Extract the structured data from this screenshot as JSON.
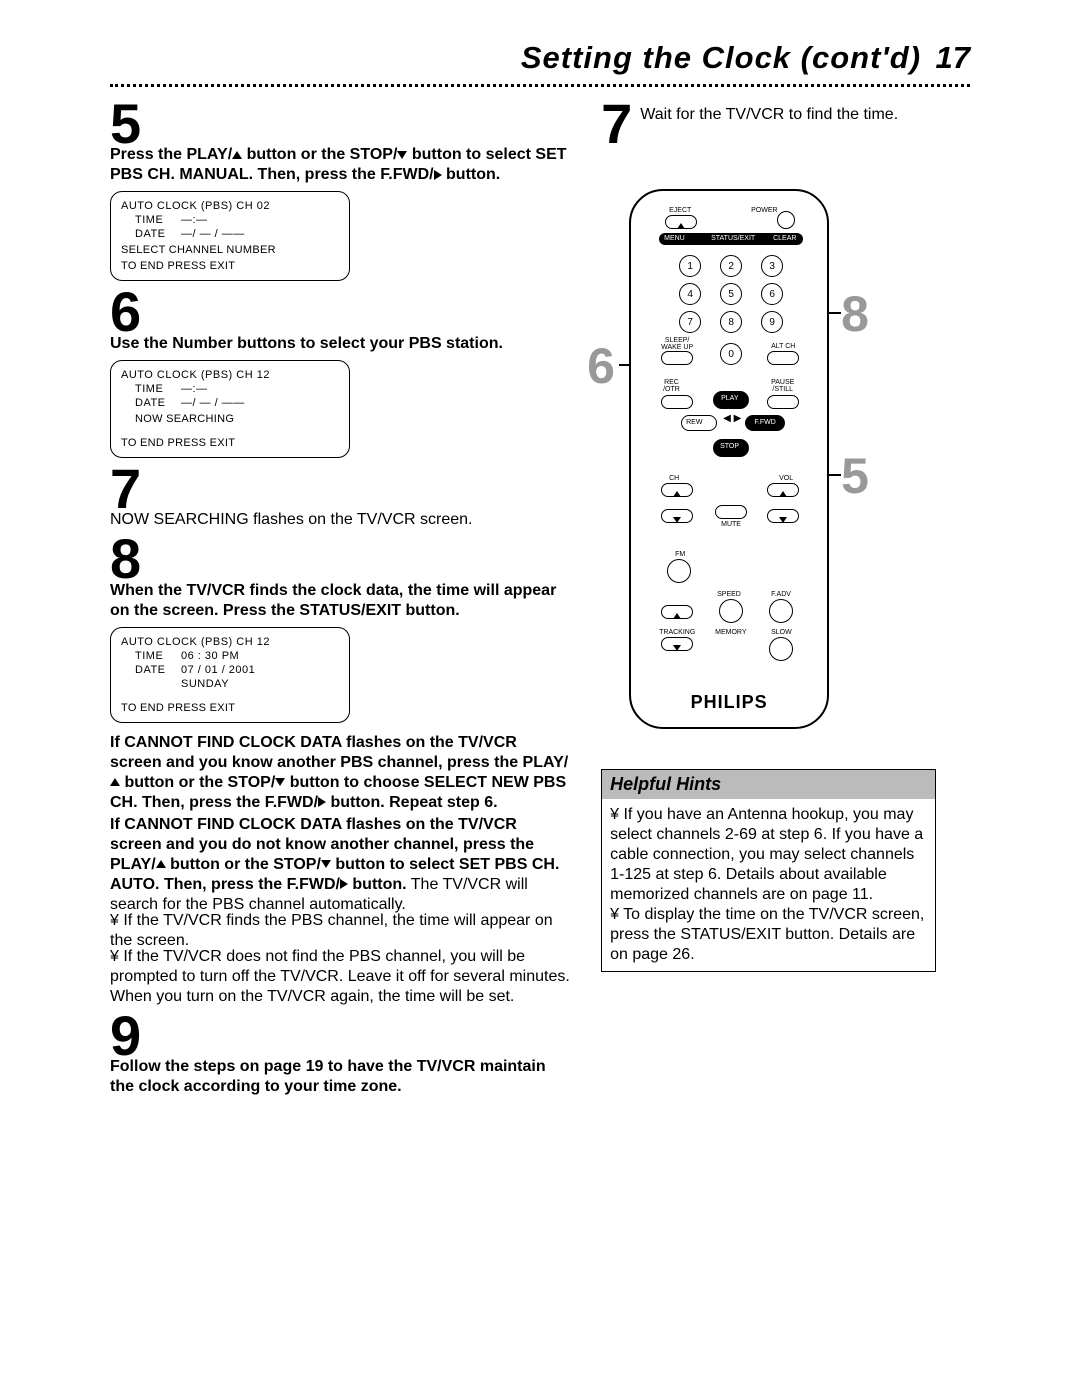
{
  "header": {
    "title": "Setting the Clock (cont'd)",
    "page": "17"
  },
  "left": {
    "step5": {
      "num": "5",
      "text_a": "Press the PLAY/",
      "text_b": "button or the STOP/",
      "text_c": "button to select SET PBS CH. MANUAL. Then, press the F.FWD/",
      "text_d": "button."
    },
    "screen1": {
      "title": "AUTO CLOCK (PBS) CH 02",
      "time_lbl": "TIME",
      "time_val": "—:—",
      "date_lbl": "DATE",
      "date_val": "—/ — / ——",
      "l1": "SELECT CHANNEL NUMBER",
      "l2": "TO END PRESS EXIT"
    },
    "step6": {
      "num": "6",
      "text": "Use the Number buttons to select your PBS station."
    },
    "screen2": {
      "title": "AUTO CLOCK (PBS) CH 12",
      "time_lbl": "TIME",
      "time_val": "—:—",
      "date_lbl": "DATE",
      "date_val": "—/ — / ——",
      "l1": "NOW SEARCHING",
      "l2": "TO END PRESS EXIT"
    },
    "step7": {
      "num": "7",
      "text": "NOW SEARCHING flashes on the TV/VCR screen."
    },
    "step8": {
      "num": "8",
      "text": "When the TV/VCR finds the clock data, the time will appear on the screen. Press the STATUS/EXIT button."
    },
    "screen3": {
      "title": "AUTO CLOCK (PBS) CH 12",
      "time_lbl": "TIME",
      "time_val": "06 : 30 PM",
      "date_lbl": "DATE",
      "date_val": "07 / 01 / 2001",
      "day": "SUNDAY",
      "l2": "TO END PRESS EXIT"
    },
    "para1_a": "If CANNOT FIND CLOCK DATA flashes on the TV/VCR screen and you know another PBS channel, press the PLAY/",
    "para1_b": "button or the STOP/",
    "para1_c": "button to choose SELECT NEW PBS CH. Then, press the F.FWD/",
    "para1_d": "button. Repeat step 6.",
    "para2_a": "If CANNOT FIND CLOCK DATA flashes on the TV/VCR screen and you do not know another channel, press the PLAY/",
    "para2_b": "button or the STOP/",
    "para2_c": "button to select SET PBS CH. AUTO",
    "para2_d": ". Then, press the F.FWD/",
    "para2_e": "button.",
    "para2_tail": " The TV/VCR will search for the PBS channel automatically.",
    "bullet1": "¥ If the TV/VCR finds the PBS channel, the time will appear on the screen.",
    "bullet2": "¥ If the TV/VCR does not find the PBS channel, you will be prompted to turn off the TV/VCR. Leave it off for several minutes. When you turn on the TV/VCR again, the time will be set.",
    "step9": {
      "num": "9",
      "text": "Follow the steps on page 19 to have the TV/VCR maintain the clock according to your time zone."
    }
  },
  "right": {
    "step7": {
      "num": "7",
      "text": "Wait for the TV/VCR to find the time."
    },
    "callout6": "6",
    "callout8": "8",
    "callout5": "5",
    "brand": "PHILIPS",
    "labels": {
      "eject": "EJECT",
      "power": "POWER",
      "menu": "MENU",
      "status": "STATUS/EXIT",
      "clear": "CLEAR",
      "sleep": "SLEEP/\nWAKE UP",
      "altch": "ALT CH",
      "rec": "REC\n/OTR",
      "pause": "PAUSE\n/STILL",
      "play": "PLAY",
      "rew": "REW",
      "ffwd": "F.FWD",
      "stop": "STOP",
      "ch": "CH",
      "vol": "VOL",
      "mute": "MUTE",
      "fm": "FM",
      "speed": "SPEED",
      "fadv": "F.ADV",
      "tracking": "TRACKING",
      "memory": "MEMORY",
      "slow": "SLOW"
    },
    "nums": {
      "n1": "1",
      "n2": "2",
      "n3": "3",
      "n4": "4",
      "n5": "5",
      "n6": "6",
      "n7": "7",
      "n8": "8",
      "n9": "9",
      "n0": "0"
    }
  },
  "hints": {
    "head": "Helpful Hints",
    "b1": "¥   If you have an Antenna hookup, you may select channels 2-69 at step 6. If you have a cable connection, you may select channels 1-125 at step 6. Details about available memorized channels are on page 11.",
    "b2": "¥   To display the time on the TV/VCR screen, press the STATUS/EXIT button. Details are on page 26."
  }
}
